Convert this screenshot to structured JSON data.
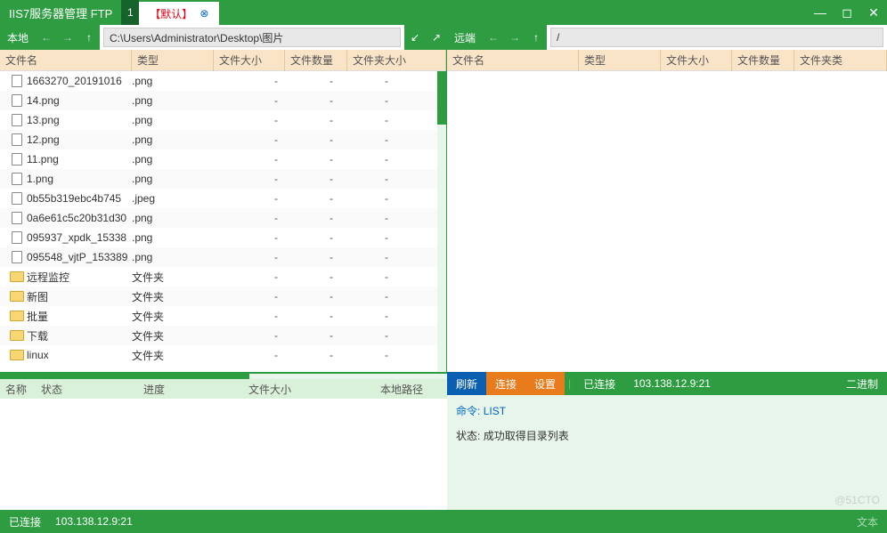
{
  "title": "IIS7服务器管理  FTP",
  "tab": {
    "num": "1",
    "default_label": "【默认】"
  },
  "nav": {
    "local_label": "本地",
    "remote_label": "远端",
    "local_path": "C:\\Users\\Administrator\\Desktop\\图片",
    "remote_path": "/"
  },
  "columns": {
    "name": "文件名",
    "type": "类型",
    "size": "文件大小",
    "count": "文件数量",
    "folder_size": "文件夹大小",
    "folder_count": "文件夹类"
  },
  "local_files": [
    {
      "name": "linux",
      "type": "文件夹",
      "size": "-",
      "count": "-",
      "is_folder": true
    },
    {
      "name": "下载",
      "type": "文件夹",
      "size": "-",
      "count": "-",
      "is_folder": true
    },
    {
      "name": "批量",
      "type": "文件夹",
      "size": "-",
      "count": "-",
      "is_folder": true
    },
    {
      "name": "新图",
      "type": "文件夹",
      "size": "-",
      "count": "-",
      "is_folder": true
    },
    {
      "name": "远程监控",
      "type": "文件夹",
      "size": "-",
      "count": "-",
      "is_folder": true
    },
    {
      "name": "095548_vjtP_153389",
      "type": ".png",
      "size": "-",
      "count": "-",
      "is_folder": false
    },
    {
      "name": "095937_xpdk_15338",
      "type": ".png",
      "size": "-",
      "count": "-",
      "is_folder": false
    },
    {
      "name": "0a6e61c5c20b31d30",
      "type": ".png",
      "size": "-",
      "count": "-",
      "is_folder": false
    },
    {
      "name": "0b55b319ebc4b745",
      "type": ".jpeg",
      "size": "-",
      "count": "-",
      "is_folder": false
    },
    {
      "name": "1.png",
      "type": ".png",
      "size": "-",
      "count": "-",
      "is_folder": false
    },
    {
      "name": "11.png",
      "type": ".png",
      "size": "-",
      "count": "-",
      "is_folder": false
    },
    {
      "name": "12.png",
      "type": ".png",
      "size": "-",
      "count": "-",
      "is_folder": false
    },
    {
      "name": "13.png",
      "type": ".png",
      "size": "-",
      "count": "-",
      "is_folder": false
    },
    {
      "name": "14.png",
      "type": ".png",
      "size": "-",
      "count": "-",
      "is_folder": false
    },
    {
      "name": "1663270_20191016",
      "type": ".png",
      "size": "-",
      "count": "-",
      "is_folder": false
    }
  ],
  "transfer": {
    "name": "名称",
    "status": "状态",
    "progress": "进度",
    "size": "文件大小",
    "local_path": "本地路径"
  },
  "rb": {
    "refresh": "刷新",
    "connect": "连接",
    "settings": "设置",
    "connected": "已连接",
    "address": "103.138.12.9:21",
    "binary": "二进制"
  },
  "log": {
    "cmd_label": "命令:",
    "cmd": "LIST",
    "status_label": "状态:",
    "status_msg": "成功取得目录列表"
  },
  "status": {
    "connected": "已连接",
    "address": "103.138.12.9:21",
    "text_mode": "文本"
  },
  "watermark": "@51CTO"
}
